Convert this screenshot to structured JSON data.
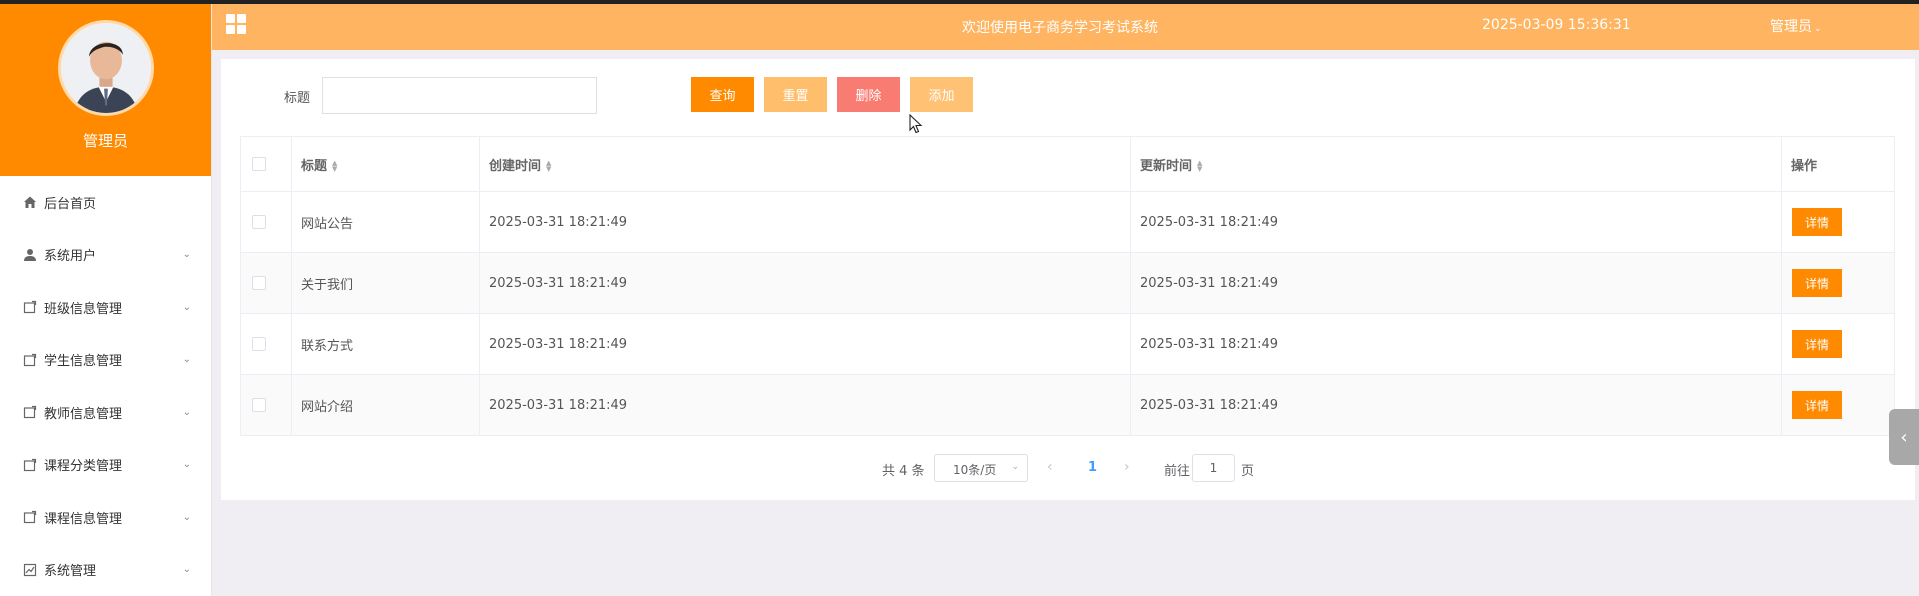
{
  "sidebar": {
    "user_name": "管理员",
    "items": [
      {
        "label": "后台首页",
        "icon": "home-icon",
        "expandable": false
      },
      {
        "label": "系统用户",
        "icon": "user-icon",
        "expandable": true
      },
      {
        "label": "班级信息管理",
        "icon": "folder-icon",
        "expandable": true
      },
      {
        "label": "学生信息管理",
        "icon": "folder-icon",
        "expandable": true
      },
      {
        "label": "教师信息管理",
        "icon": "folder-icon",
        "expandable": true
      },
      {
        "label": "课程分类管理",
        "icon": "folder-icon",
        "expandable": true
      },
      {
        "label": "课程信息管理",
        "icon": "folder-icon",
        "expandable": true
      },
      {
        "label": "系统管理",
        "icon": "chart-icon",
        "expandable": true
      }
    ]
  },
  "header": {
    "title": "欢迎使用电子商务学习考试系统",
    "datetime": "2025-03-09 15:36:31",
    "user": "管理员"
  },
  "search": {
    "label": "标题",
    "value": "",
    "placeholder": ""
  },
  "buttons": {
    "query": "查询",
    "reset": "重置",
    "delete": "删除",
    "add": "添加"
  },
  "table": {
    "columns": [
      "标题",
      "创建时间",
      "更新时间",
      "操作"
    ],
    "rows": [
      {
        "title": "网站公告",
        "created": "2025-03-31 18:21:49",
        "updated": "2025-03-31 18:21:49",
        "action": "详情"
      },
      {
        "title": "关于我们",
        "created": "2025-03-31 18:21:49",
        "updated": "2025-03-31 18:21:49",
        "action": "详情"
      },
      {
        "title": "联系方式",
        "created": "2025-03-31 18:21:49",
        "updated": "2025-03-31 18:21:49",
        "action": "详情"
      },
      {
        "title": "网站介绍",
        "created": "2025-03-31 18:21:49",
        "updated": "2025-03-31 18:21:49",
        "action": "详情"
      }
    ]
  },
  "pagination": {
    "total": "共 4 条",
    "page_size": "10条/页",
    "current_page": "1",
    "goto_label": "前往",
    "goto_value": "1",
    "page_suffix": "页"
  },
  "colors": {
    "primary": "#ff8a00",
    "header": "#ffb461",
    "reset": "#ffbe6b",
    "delete": "#f87c72",
    "add": "#ffc174"
  }
}
